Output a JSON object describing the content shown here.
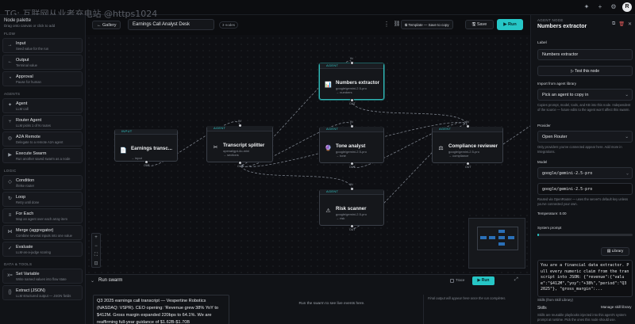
{
  "watermark": "TG: 互联网从业者充电站 @https1024",
  "topbar": {
    "icons": [
      "sparkle-icon",
      "plus-icon",
      "gear-icon"
    ],
    "avatar": "R"
  },
  "palette": {
    "title": "Node palette",
    "subtitle": "Drag onto canvas or click to add",
    "sections": [
      {
        "label": "FLOW",
        "items": [
          {
            "name": "Input",
            "desc": "Seed value for the run",
            "icon": "→"
          },
          {
            "name": "Output",
            "desc": "Terminal value",
            "icon": "←"
          },
          {
            "name": "Approval",
            "desc": "Pause for human",
            "icon": "◔"
          }
        ]
      },
      {
        "label": "AGENTS",
        "items": [
          {
            "name": "Agent",
            "desc": "LLM call",
            "icon": "✦"
          },
          {
            "name": "Router Agent",
            "desc": "LLM picks 1 of N routes",
            "icon": "⑂"
          },
          {
            "name": "A2A Remote",
            "desc": "Delegate to a remote A2A agent",
            "icon": "◎"
          },
          {
            "name": "Execute Swarm",
            "desc": "Run another saved swarm as a node",
            "icon": "▶"
          }
        ]
      },
      {
        "label": "LOGIC",
        "items": [
          {
            "name": "Condition",
            "desc": "if/else router",
            "icon": "◇"
          },
          {
            "name": "Loop",
            "desc": "Retry until done",
            "icon": "↻"
          },
          {
            "name": "For Each",
            "desc": "Map an agent over each array item",
            "icon": "≡"
          },
          {
            "name": "Merge (aggregator)",
            "desc": "Combine several inputs into one value",
            "icon": "⋈"
          },
          {
            "name": "Evaluate",
            "desc": "LLM-as-a-judge scoring",
            "icon": "✓"
          }
        ]
      },
      {
        "label": "DATA & TOOLS",
        "items": [
          {
            "name": "Set Variable",
            "desc": "Write named values into flow state",
            "icon": "x="
          },
          {
            "name": "Extract (JSON)",
            "desc": "LLM structured output — JSON fields",
            "icon": "{}"
          }
        ]
      }
    ]
  },
  "header": {
    "gallery": "Gallery",
    "title": "Earnings Call Analyst Desk",
    "node_count": "3 nodes",
    "template": "Template — Save to copy",
    "save": "Save",
    "run": "Run"
  },
  "canvas": {
    "nodes": [
      {
        "id": "input",
        "type": "INPUT",
        "name": "Earnings transc...",
        "meta": "",
        "out": "→ input",
        "icon": "📄",
        "sel": false
      },
      {
        "id": "splitter",
        "type": "AGENT",
        "name": "Transcript splitter",
        "meta": "openai/gpt-4o-mini",
        "out": "→ sections",
        "icon": "✂",
        "sel": false
      },
      {
        "id": "numbers",
        "type": "AGENT",
        "name": "Numbers extractor",
        "meta": "google/gemini-2.5-pro",
        "out": "→ numbers",
        "icon": "📊",
        "sel": true
      },
      {
        "id": "tone",
        "type": "AGENT",
        "name": "Tone analyst",
        "meta": "google/gemini-2.5-pro",
        "out": "→ tone",
        "icon": "🔮",
        "sel": false
      },
      {
        "id": "compliance",
        "type": "AGENT",
        "name": "Compliance reviewer",
        "meta": "google/gemini-2.5-pro",
        "out": "→ compliance",
        "icon": "⚖",
        "sel": false
      },
      {
        "id": "risk",
        "type": "AGENT",
        "name": "Risk scanner",
        "meta": "google/gemini-2.5-pro",
        "out": "→ risk",
        "icon": "⚠",
        "sel": false
      }
    ],
    "port_labels": {
      "in": "IN",
      "out": "OUT"
    },
    "zoom_controls": [
      "+",
      "−",
      "⛶",
      "🔒"
    ]
  },
  "bottom": {
    "title": "Run swarm",
    "trace_label": "Trace",
    "run": "Run",
    "transcript": "Q3 2025 earnings call transcript — Vespertine Robotics (NASDAQ: VSPR). CEO opening: 'Revenue grew 38% YoY to $412M. Gross margin expanded 220bps to 64.1%. We are reaffirming full-year guidance of $1.62B-$1.70B",
    "events_placeholder": "Run the swarm to see live events here.",
    "final_placeholder": "Final output will appear here once the run completes."
  },
  "inspector": {
    "kicker": "AGENT NODE",
    "title": "Numbers extractor",
    "label_label": "Label",
    "label_value": "Numbers extractor",
    "test_button": "Test this node",
    "import_label": "Import from agent library",
    "import_value": "Pick an agent to copy in",
    "import_help": "Copies prompt, model, tools, and KB into this node. Independent of the source — future edits to the agent won't affect this swarm.",
    "provider_label": "Provider",
    "provider_value": "Open Router",
    "provider_help": "Only providers you've connected appear here. Add more in Integrations.",
    "model_label": "Model",
    "model_select": "google/gemini-2.5-pro",
    "model_value": "google/gemini-2.5-pro",
    "model_help": "Routed via OpenRouter — uses the server's default key unless you've connected your own.",
    "temperature_label": "Temperature: 0.00",
    "temperature": 0.0,
    "system_prompt_label": "System prompt",
    "library_button": "Library",
    "system_prompt": "You are a financial data extractor. Pull every numeric claim from the transcript into JSON: {\"revenue\":{\"value\":\"$412M\",\"yoy\":\"+38%\",\"period\":\"Q3 2025\"}, \"gross_margin\":...",
    "skills_label": "Skills (from Skill Library)",
    "skills_section": "Skills",
    "manage_skills": "Manage skill library",
    "skills_help": "Skills are reusable playbooks injected into this agent's system prompt at runtime. Pick the ones this node should use."
  },
  "colors": {
    "accent": "#26c6c6",
    "node_border": "#3a3f48",
    "selected": "#2fb8b8",
    "danger": "#e05a5a"
  }
}
